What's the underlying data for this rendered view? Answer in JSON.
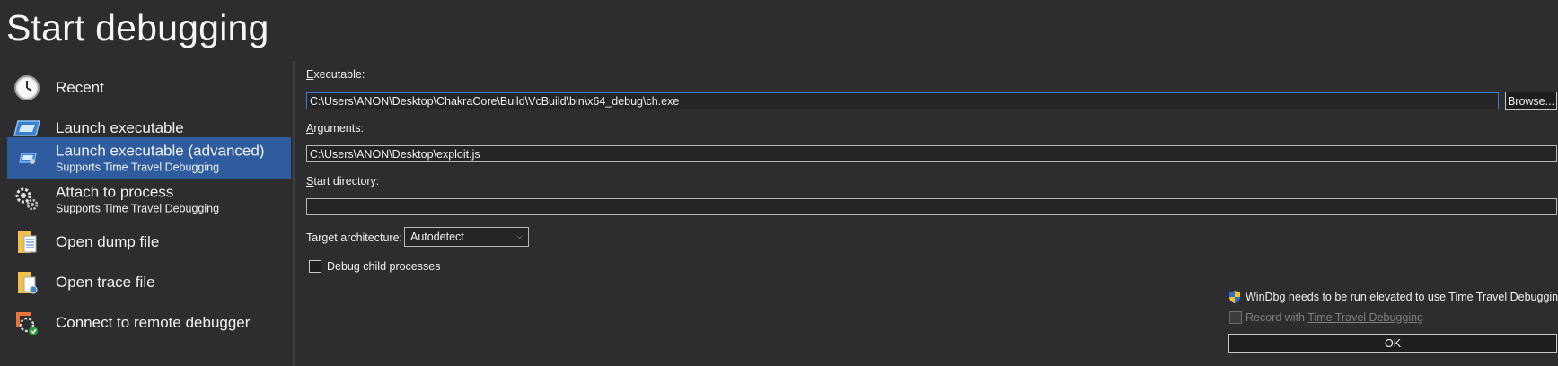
{
  "page": {
    "title": "Start debugging"
  },
  "sidebar": {
    "items": [
      {
        "label": "Recent",
        "sub": "",
        "icon": "clock-icon",
        "selected": false
      },
      {
        "label": "Launch executable",
        "sub": "",
        "icon": "executable-window-icon",
        "selected": false
      },
      {
        "label": "Launch executable (advanced)",
        "sub": "Supports Time Travel Debugging",
        "icon": "executable-advanced-icon",
        "selected": true
      },
      {
        "label": "Attach to process",
        "sub": "Supports Time Travel Debugging",
        "icon": "gears-icon",
        "selected": false
      },
      {
        "label": "Open dump file",
        "sub": "",
        "icon": "dump-file-icon",
        "selected": false
      },
      {
        "label": "Open trace file",
        "sub": "",
        "icon": "trace-file-icon",
        "selected": false
      },
      {
        "label": "Connect to remote debugger",
        "sub": "",
        "icon": "remote-debugger-icon",
        "selected": false
      }
    ]
  },
  "form": {
    "executable": {
      "label_first": "E",
      "label_rest": "xecutable:",
      "value": "C:\\Users\\ANON\\Desktop\\ChakraCore\\Build\\VcBuild\\bin\\x64_debug\\ch.exe",
      "browse_label": "Browse..."
    },
    "arguments": {
      "label_first": "A",
      "label_rest": "rguments:",
      "value": "C:\\Users\\ANON\\Desktop\\exploit.js"
    },
    "start_directory": {
      "label_first": "S",
      "label_rest": "tart directory:",
      "value": ""
    },
    "target_architecture": {
      "label": "Target architecture:",
      "value": "Autodetect"
    },
    "debug_child": {
      "label": "Debug child processes",
      "checked": false
    }
  },
  "ttd": {
    "warning": "WinDbg needs to be run elevated to use Time Travel Debugging",
    "record_prefix": "Record with ",
    "record_link": "Time Travel Debugging",
    "record_checked": false,
    "ok_label": "OK"
  },
  "colors": {
    "background": "#2d2d30",
    "selected": "#2f5c9f",
    "focus_border": "#3d7bd1"
  }
}
